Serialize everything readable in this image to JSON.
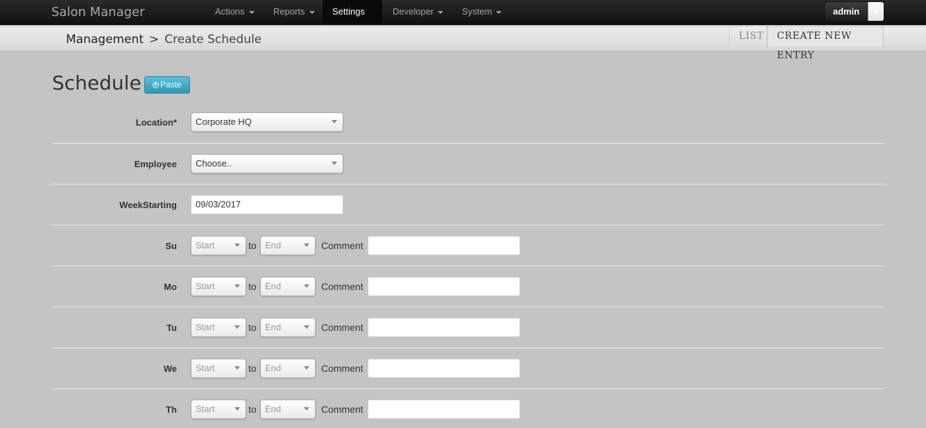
{
  "app": {
    "title": "Salon Manager"
  },
  "nav": {
    "items": [
      {
        "label": "Actions"
      },
      {
        "label": "Reports"
      },
      {
        "label": "Settings"
      },
      {
        "label": "Developer"
      },
      {
        "label": "System"
      }
    ],
    "active": "Settings",
    "user": "admin"
  },
  "breadcrumb": {
    "parent": "Management",
    "separator": ">",
    "current": "Create Schedule"
  },
  "subtabs": [
    {
      "label": "LIST"
    },
    {
      "label": "CREATE NEW ENTRY"
    }
  ],
  "page": {
    "title": "Schedule",
    "paste_label": "Paste"
  },
  "form": {
    "location": {
      "label": "Location*",
      "value": "Corporate HQ"
    },
    "employee": {
      "label": "Employee",
      "value": "Choose.."
    },
    "week": {
      "label": "WeekStarting",
      "value": "09/03/2017"
    },
    "days": [
      {
        "label": "Su",
        "start": "Start",
        "to": "to",
        "end": "End",
        "comment_label": "Comment",
        "comment": ""
      },
      {
        "label": "Mo",
        "start": "Start",
        "to": "to",
        "end": "End",
        "comment_label": "Comment",
        "comment": ""
      },
      {
        "label": "Tu",
        "start": "Start",
        "to": "to",
        "end": "End",
        "comment_label": "Comment",
        "comment": ""
      },
      {
        "label": "We",
        "start": "Start",
        "to": "to",
        "end": "End",
        "comment_label": "Comment",
        "comment": ""
      },
      {
        "label": "Th",
        "start": "Start",
        "to": "to",
        "end": "End",
        "comment_label": "Comment",
        "comment": ""
      }
    ]
  }
}
